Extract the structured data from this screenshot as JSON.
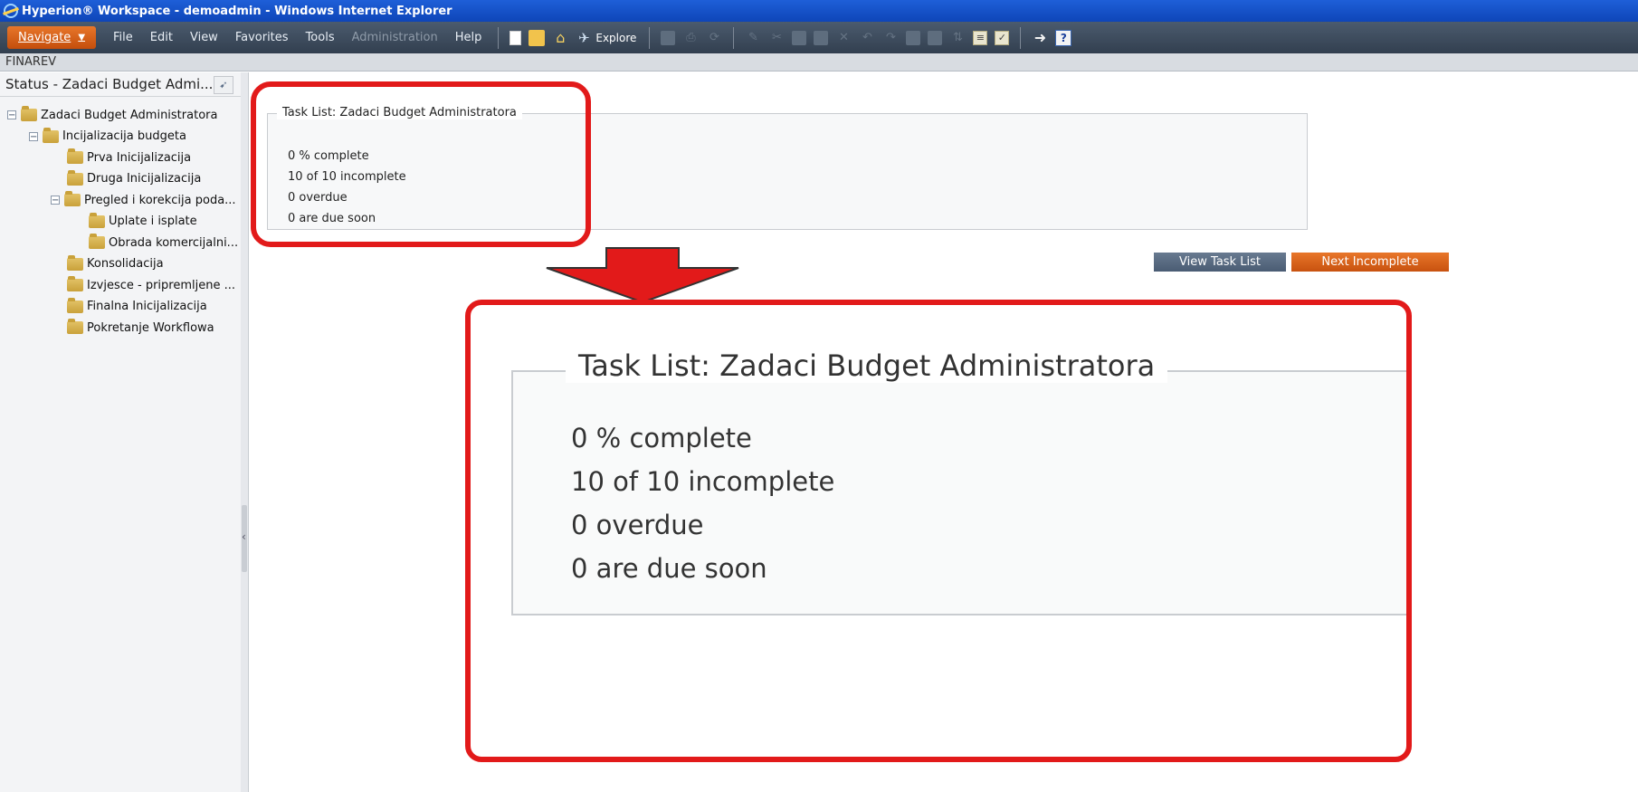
{
  "window": {
    "title": "Hyperion® Workspace - demoadmin - Windows Internet Explorer"
  },
  "menubar": {
    "navigate_label": "Navigate",
    "items": [
      "File",
      "Edit",
      "View",
      "Favorites",
      "Tools",
      "Administration",
      "Help"
    ],
    "explore_label": "Explore"
  },
  "app": {
    "name": "FINAREV"
  },
  "left_panel": {
    "title": "Status - Zadaci Budget Admi...",
    "tree": [
      {
        "label": "Zadaci Budget Administratora",
        "toggle": "−"
      },
      {
        "label": "Incijalizacija budgeta",
        "toggle": "−"
      },
      {
        "label": "Prva Inicijalizacija"
      },
      {
        "label": "Druga Inicijalizacija"
      },
      {
        "label": "Pregled i korekcija poda...",
        "toggle": "−"
      },
      {
        "label": "Uplate i isplate"
      },
      {
        "label": "Obrada komercijalni..."
      },
      {
        "label": "Konsolidacija"
      },
      {
        "label": "Izvjesce - pripremljene ..."
      },
      {
        "label": "Finalna Inicijalizacija"
      },
      {
        "label": "Pokretanje Workflowa"
      }
    ]
  },
  "task_summary": {
    "legend": "Task List: Zadaci Budget Administratora",
    "lines": [
      "0 % complete",
      "10  of  10  incomplete",
      "0  overdue",
      "0  are due soon"
    ]
  },
  "buttons": {
    "view_task_list": "View Task List",
    "next_incomplete": "Next Incomplete"
  },
  "colors": {
    "annotation_red": "#e21a1a",
    "accent_orange": "#d85f14",
    "toolbar_dark": "#3c4a5b"
  }
}
